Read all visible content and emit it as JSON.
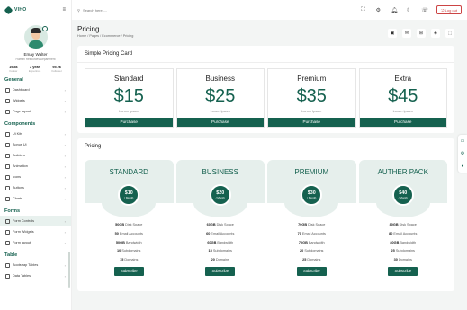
{
  "app": {
    "logo_text": "VIHO"
  },
  "profile": {
    "name": "Emay Walter",
    "role": "Human Resources Department",
    "stats": [
      {
        "value": "19.8k",
        "label": "Follow"
      },
      {
        "value": "2 year",
        "label": "Experince"
      },
      {
        "value": "95.2k",
        "label": "Follower"
      }
    ]
  },
  "sidebar": {
    "sections": [
      {
        "title": "General",
        "items": [
          {
            "label": "Dashboard"
          },
          {
            "label": "Widgets"
          },
          {
            "label": "Page layout"
          }
        ]
      },
      {
        "title": "Components",
        "items": [
          {
            "label": "Ui Kits"
          },
          {
            "label": "Bonus Ui"
          },
          {
            "label": "Builders"
          },
          {
            "label": "Animation"
          },
          {
            "label": "Icons"
          },
          {
            "label": "Buttons"
          },
          {
            "label": "Charts"
          }
        ]
      },
      {
        "title": "Forms",
        "items": [
          {
            "label": "Form Controls"
          },
          {
            "label": "Form Widgets"
          },
          {
            "label": "Form layout"
          }
        ]
      },
      {
        "title": "Table",
        "items": [
          {
            "label": "Bootstrap Tables"
          },
          {
            "label": "Data Tables"
          }
        ]
      }
    ]
  },
  "topbar": {
    "search_placeholder": "Search here.....",
    "logout_label": "Log out"
  },
  "page": {
    "title": "Pricing",
    "breadcrumb": [
      "Home",
      "Pages",
      "Ecommerce",
      "Pricing"
    ]
  },
  "simple_card": {
    "title": "Simple Pricing Card",
    "plans": [
      {
        "name": "Standard",
        "price": "$15",
        "sub": "Lorum Ipsum",
        "button": "Purchase"
      },
      {
        "name": "Business",
        "price": "$25",
        "sub": "Lorum Ipsum",
        "button": "Purchase"
      },
      {
        "name": "Premium",
        "price": "$35",
        "sub": "Lorum Ipsum",
        "button": "Purchase"
      },
      {
        "name": "Extra",
        "price": "$45",
        "sub": "Lorum Ipsum",
        "button": "Purchase"
      }
    ]
  },
  "pricing": {
    "title": "Pricing",
    "plans": [
      {
        "name": "STANDARD",
        "price": "$10",
        "period": "/ Month",
        "features": [
          [
            "50GB",
            "Disk Space"
          ],
          [
            "50",
            "Email Accounts"
          ],
          [
            "50GB",
            "Bandwidth"
          ],
          [
            "10",
            "Subdomains"
          ],
          [
            "15",
            "Domains"
          ]
        ],
        "button": "Subscribe"
      },
      {
        "name": "BUSINESS",
        "price": "$20",
        "period": "/ Month",
        "features": [
          [
            "60GB",
            "Disk Space"
          ],
          [
            "60",
            "Email Accounts"
          ],
          [
            "60GB",
            "Bandwidth"
          ],
          [
            "15",
            "Subdomains"
          ],
          [
            "20",
            "Domains"
          ]
        ],
        "button": "Subscribe"
      },
      {
        "name": "PREMIUM",
        "price": "$30",
        "period": "/ Month",
        "features": [
          [
            "70GB",
            "Disk Space"
          ],
          [
            "70",
            "Email Accounts"
          ],
          [
            "70GB",
            "Bandwidth"
          ],
          [
            "20",
            "Subdomains"
          ],
          [
            "25",
            "Domains"
          ]
        ],
        "button": "Subscribe"
      },
      {
        "name": "AUTHER PACK",
        "price": "$40",
        "period": "/ Month",
        "features": [
          [
            "80GB",
            "Disk Space"
          ],
          [
            "80",
            "Email Accounts"
          ],
          [
            "80GB",
            "Bandwidth"
          ],
          [
            "25",
            "Subdomains"
          ],
          [
            "30",
            "Domains"
          ]
        ],
        "button": "Subscribe"
      }
    ]
  },
  "colors": {
    "brand": "#15614f",
    "danger": "#cc4444"
  }
}
